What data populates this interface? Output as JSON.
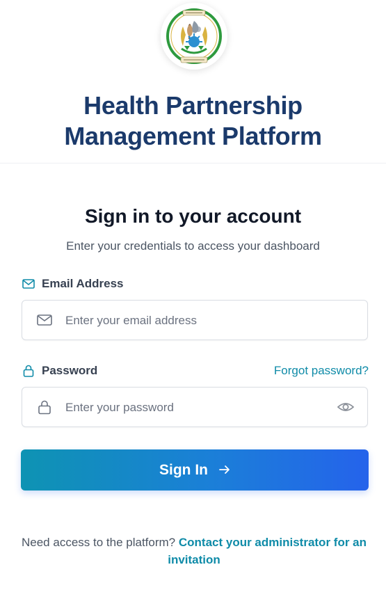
{
  "header": {
    "title_line1": "Health Partnership",
    "title_line2": "Management Platform",
    "logo": {
      "icon": "rwanda-coat-of-arms-icon",
      "motto_top": "REPUBULIKA Y'U RWANDA",
      "motto_bottom": "UBUMWE · UMURIMO · GUKUNDA IGIHUGU"
    }
  },
  "signin": {
    "title": "Sign in to your account",
    "subtitle": "Enter your credentials to access your dashboard",
    "email": {
      "label": "Email Address",
      "label_icon": "mail-icon",
      "input_icon": "mail-icon",
      "value": "",
      "placeholder": "Enter your email address"
    },
    "password": {
      "label": "Password",
      "label_icon": "lock-icon",
      "input_icon": "lock-icon",
      "value": "",
      "placeholder": "Enter your password",
      "toggle_icon": "eye-icon"
    },
    "forgot_link": "Forgot password?",
    "submit_label": "Sign In",
    "submit_icon": "arrow-right-icon"
  },
  "footer": {
    "prompt": "Need access to the platform?",
    "link": "Contact your administrator for an invitation"
  },
  "colors": {
    "title": "#1b3a6b",
    "link": "#0f8ba8",
    "button_start": "#0e93b3",
    "button_end": "#2563eb"
  }
}
